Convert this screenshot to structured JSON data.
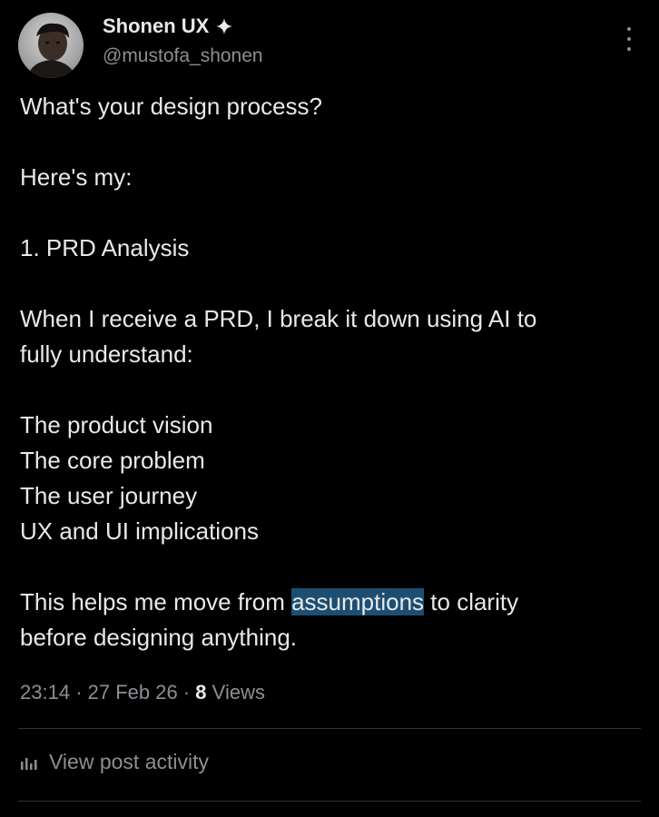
{
  "author": {
    "name": "Shonen UX",
    "handle": "@mustofa_shonen"
  },
  "post": {
    "paragraphs": [
      [
        "What's your design process?"
      ],
      [
        "Here's my:"
      ],
      [
        "1. PRD Analysis"
      ],
      [
        "When I receive a PRD, I break it down using AI to",
        "fully understand:"
      ],
      [
        "The product vision",
        "The core problem",
        "The user journey",
        "UX and UI implications"
      ]
    ],
    "final_before": "This helps me move from ",
    "final_highlight": "assumptions",
    "final_after": " to clarity",
    "final_line2": "before designing anything."
  },
  "meta": {
    "time": "23:14",
    "date": "27 Feb 26",
    "views_count": "8",
    "views_label": "Views"
  },
  "activity": {
    "label": "View post activity"
  },
  "colors": {
    "background": "#000000",
    "text": "#e7e9ea",
    "muted": "#8b8f94",
    "highlight": "#1d4e72",
    "divider": "#2f3336"
  }
}
